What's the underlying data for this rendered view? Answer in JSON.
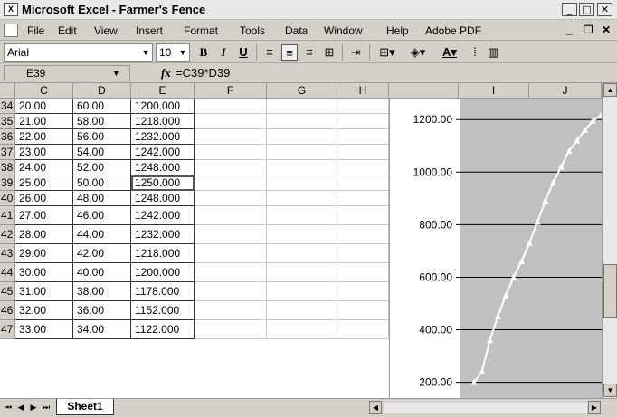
{
  "titlebar": {
    "icon_label": "X",
    "title": "Microsoft Excel - Farmer's Fence"
  },
  "menu": [
    "File",
    "Edit",
    "View",
    "Insert",
    "Format",
    "Tools",
    "Data",
    "Window",
    "Help",
    "Adobe PDF"
  ],
  "toolbar": {
    "font": "Arial",
    "size": "10"
  },
  "formula_bar": {
    "cell_ref": "E39",
    "fx": "fx",
    "formula": "=C39*D39"
  },
  "columns": [
    "C",
    "D",
    "E",
    "F",
    "G",
    "H",
    "I",
    "J"
  ],
  "rows": [
    {
      "n": "34",
      "c": "20.00",
      "d": "60.00",
      "e": "1200.000"
    },
    {
      "n": "35",
      "c": "21.00",
      "d": "58.00",
      "e": "1218.000"
    },
    {
      "n": "36",
      "c": "22.00",
      "d": "56.00",
      "e": "1232.000"
    },
    {
      "n": "37",
      "c": "23.00",
      "d": "54.00",
      "e": "1242.000"
    },
    {
      "n": "38",
      "c": "24.00",
      "d": "52.00",
      "e": "1248.000"
    },
    {
      "n": "39",
      "c": "25.00",
      "d": "50.00",
      "e": "1250.000"
    },
    {
      "n": "40",
      "c": "26.00",
      "d": "48.00",
      "e": "1248.000"
    },
    {
      "n": "41",
      "c": "27.00",
      "d": "46.00",
      "e": "1242.000"
    },
    {
      "n": "42",
      "c": "28.00",
      "d": "44.00",
      "e": "1232.000"
    },
    {
      "n": "43",
      "c": "29.00",
      "d": "42.00",
      "e": "1218.000"
    },
    {
      "n": "44",
      "c": "30.00",
      "d": "40.00",
      "e": "1200.000"
    },
    {
      "n": "45",
      "c": "31.00",
      "d": "38.00",
      "e": "1178.000"
    },
    {
      "n": "46",
      "c": "32.00",
      "d": "36.00",
      "e": "1152.000"
    },
    {
      "n": "47",
      "c": "33.00",
      "d": "34.00",
      "e": "1122.000"
    }
  ],
  "selected_cell": "E39",
  "sheet_tab": "Sheet1",
  "chart_data": {
    "type": "line",
    "title": "",
    "xlabel": "",
    "ylabel": "",
    "y_ticks": [
      "1200.00",
      "1000.00",
      "800.00",
      "600.00",
      "400.00",
      "200.00"
    ],
    "ylim": [
      140,
      1280
    ],
    "grid": true,
    "series": [
      {
        "values": [
          200,
          240,
          360,
          450,
          530,
          600,
          660,
          730,
          810,
          890,
          960,
          1020,
          1080,
          1120,
          1160,
          1195,
          1215
        ]
      }
    ]
  }
}
